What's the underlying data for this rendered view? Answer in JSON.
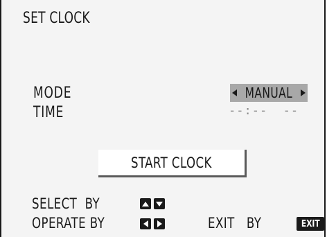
{
  "screen": {
    "title": "SET CLOCK"
  },
  "settings": {
    "mode_label": "MODE",
    "mode_value": "MANUAL",
    "time_label": "TIME",
    "time_value": "--:--  --"
  },
  "actions": {
    "start_clock_label": "START CLOCK"
  },
  "help": {
    "select_text": "SELECT  BY",
    "operate_text": "OPERATE BY",
    "exit_text": "EXIT   BY",
    "exit_key_label": "EXIT",
    "select_keys": [
      "up-arrow-icon",
      "down-arrow-icon"
    ],
    "operate_keys": [
      "left-arrow-icon",
      "right-arrow-icon"
    ]
  },
  "colors": {
    "background": "#f4f4f4",
    "selection_highlight": "#a8a8a8",
    "text": "#1a1a1a",
    "placeholder_text": "#8a8a8a",
    "button_face": "#ffffff",
    "key_background": "#1a1a1a"
  }
}
